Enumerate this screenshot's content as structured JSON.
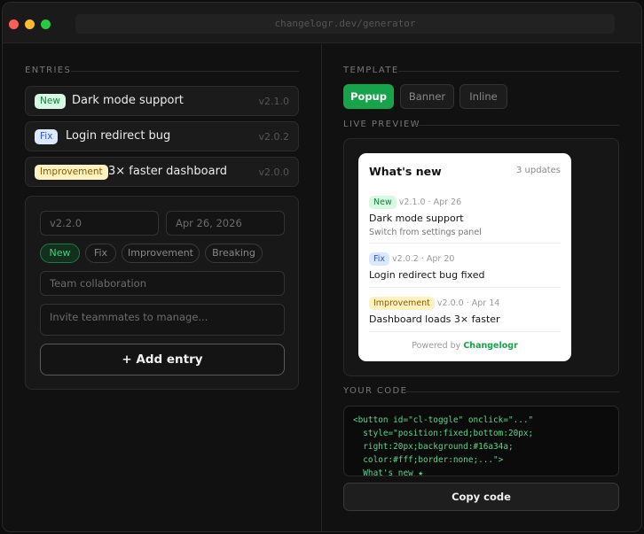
{
  "window": {
    "url": "changelogr.dev/generator"
  },
  "left": {
    "entries_label": "ENTRIES",
    "entries": [
      {
        "badge": "New",
        "badge_type": "new",
        "title": "Dark mode support",
        "version": "v2.1.0"
      },
      {
        "badge": "Fix",
        "badge_type": "fix",
        "title": "Login redirect bug",
        "version": "v2.0.2"
      },
      {
        "badge": "Improvement",
        "badge_type": "imp",
        "title": "3× faster dashboard",
        "version": "v2.0.0"
      }
    ],
    "form": {
      "version_placeholder": "v2.2.0",
      "date_placeholder": "Apr 26, 2026",
      "types": [
        "New",
        "Fix",
        "Improvement",
        "Breaking"
      ],
      "selected_type": "New",
      "title_placeholder": "Team collaboration",
      "description_placeholder": "Invite teammates to manage...",
      "add_label": "+ Add entry"
    }
  },
  "right": {
    "template_label": "TEMPLATE",
    "templates": [
      "Popup",
      "Banner",
      "Inline"
    ],
    "selected_template": "Popup",
    "preview_label": "LIVE PREVIEW",
    "popup": {
      "title": "What's new",
      "count": "3 updates",
      "items": [
        {
          "badge": "New",
          "badge_type": "new",
          "meta": "v2.1.0 · Apr 26",
          "title": "Dark mode support",
          "desc": "Switch from settings panel"
        },
        {
          "badge": "Fix",
          "badge_type": "fix",
          "meta": "v2.0.2 · Apr 20",
          "title": "Login redirect bug fixed",
          "desc": ""
        },
        {
          "badge": "Improvement",
          "badge_type": "imp",
          "meta": "v2.0.0 · Apr 14",
          "title": "Dashboard loads 3× faster",
          "desc": ""
        }
      ],
      "powered_prefix": "Powered by ",
      "powered_brand": "Changelogr"
    },
    "code_label": "YOUR CODE",
    "code": "<button id=\"cl-toggle\" onclick=\"...\"\n  style=\"position:fixed;bottom:20px;\n  right:20px;background:#16a34a;\n  color:#fff;border:none;...\">\n  What's new ★",
    "copy_label": "Copy code"
  },
  "colors": {
    "accent": "#16a34a",
    "background": "#111111"
  }
}
